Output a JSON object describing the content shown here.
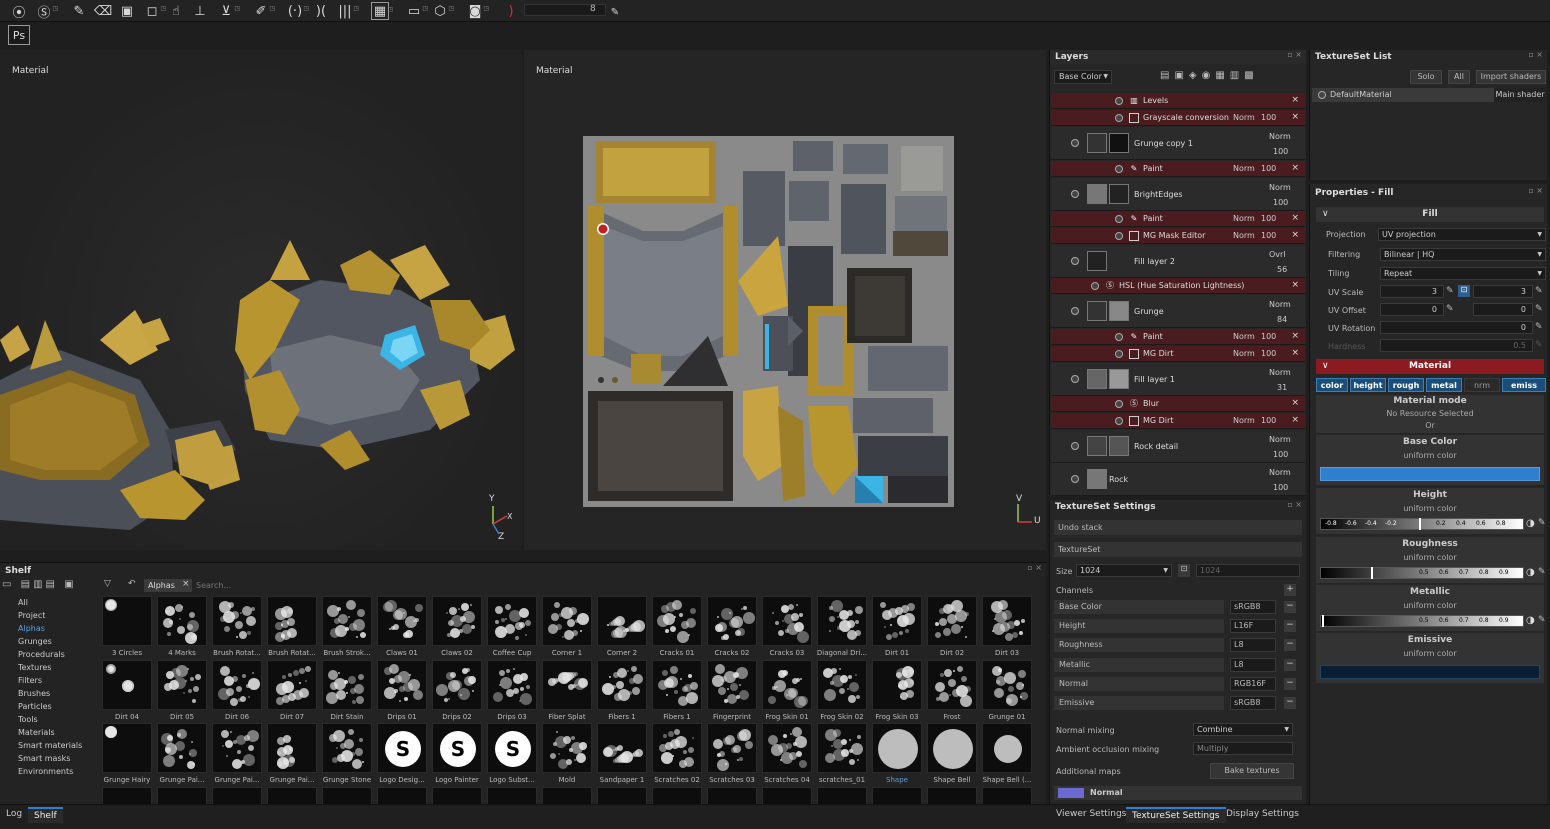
{
  "toolbar": {
    "icons": [
      "substance-logo-icon",
      "substance-s-icon",
      "brush-icon",
      "eraser-icon",
      "projection-icon",
      "polygon-fill-icon",
      "smudge-icon",
      "clone-icon",
      "clone-stamp-icon",
      "picker-icon",
      "symmetry-icon",
      "mirror-icon",
      "mirror-alt-icon",
      "texture-icon",
      "camera-icon",
      "cube-icon",
      "screenshot-icon",
      "bracket-icon"
    ],
    "slider_value": "8",
    "ps_label": "Ps"
  },
  "viewport3d": {
    "label": "Material",
    "axis_y": "Y",
    "axis_x": "X",
    "axis_z": "Z"
  },
  "viewport2d": {
    "label": "Material",
    "axis_v": "V",
    "axis_u": "U"
  },
  "layers": {
    "title": "Layers",
    "channel_select": "Base Color",
    "rows": [
      {
        "name": "Levels",
        "blend": "",
        "opacity": ""
      },
      {
        "name": "Grayscale conversion",
        "blend": "Norm",
        "opacity": "100"
      },
      {
        "name": "Grunge copy 1",
        "blend": "Norm",
        "opacity": "100"
      },
      {
        "name": "Paint",
        "blend": "Norm",
        "opacity": "100"
      },
      {
        "name": "BrightEdges",
        "blend": "Norm",
        "opacity": "100"
      },
      {
        "name": "Paint",
        "blend": "Norm",
        "opacity": "100"
      },
      {
        "name": "MG Mask Editor",
        "blend": "Norm",
        "opacity": "100"
      },
      {
        "name": "Fill layer 2",
        "blend": "Ovrl",
        "opacity": "56"
      },
      {
        "name": "HSL (Hue Saturation Lightness)",
        "blend": "",
        "opacity": ""
      },
      {
        "name": "Grunge",
        "blend": "Norm",
        "opacity": "84"
      },
      {
        "name": "Paint",
        "blend": "Norm",
        "opacity": "100"
      },
      {
        "name": "MG Dirt",
        "blend": "Norm",
        "opacity": "100"
      },
      {
        "name": "Fill layer 1",
        "blend": "Norm",
        "opacity": "31"
      },
      {
        "name": "Blur",
        "blend": "",
        "opacity": ""
      },
      {
        "name": "MG Dirt",
        "blend": "Norm",
        "opacity": "100"
      },
      {
        "name": "Rock detail",
        "blend": "Norm",
        "opacity": "100"
      },
      {
        "name": "Rock",
        "blend": "Norm",
        "opacity": "100"
      }
    ]
  },
  "texture_set_list": {
    "title": "TextureSet List",
    "solo": "Solo",
    "all": "All",
    "import": "Import shaders",
    "material": "DefaultMaterial",
    "shader": "Main shader"
  },
  "properties": {
    "title": "Properties - Fill",
    "fill_header": "Fill",
    "projection_label": "Projection",
    "projection_value": "UV projection",
    "filtering_label": "Filtering",
    "filtering_value": "Bilinear | HQ",
    "tiling_label": "Tiling",
    "tiling_value": "Repeat",
    "uvscale_label": "UV Scale",
    "uvscale_a": "3",
    "uvscale_b": "3",
    "uvoffset_label": "UV Offset",
    "uvoffset_a": "0",
    "uvoffset_b": "0",
    "uvrotation_label": "UV Rotation",
    "uvrotation_value": "0",
    "hardness_label": "Hardness",
    "hardness_value": "0.5",
    "material_header": "Material",
    "channel_tabs": [
      "color",
      "height",
      "rough",
      "metal",
      "nrm",
      "emiss"
    ],
    "material_mode": "Material mode",
    "no_resource": "No Resource Selected",
    "or": "Or",
    "base_color": "Base Color",
    "height": "Height",
    "roughness": "Roughness",
    "metallic": "Metallic",
    "emissive": "Emissive",
    "uniform": "uniform color",
    "base_color_hex": "#2f7fd0",
    "emissive_hex": "#0a1f36",
    "height_ticks": [
      "-0.8",
      "-0.6",
      "-0.4",
      "-0.2",
      "0.2",
      "0.4",
      "0.6",
      "0.8"
    ],
    "unit_ticks": [
      "0.5",
      "0.6",
      "0.7",
      "0.8",
      "0.9"
    ]
  },
  "texture_set_settings": {
    "title": "TextureSet Settings",
    "undo": "Undo stack",
    "textureset": "TextureSet",
    "size_label": "Size",
    "size_value": "1024",
    "size_value2": "1024",
    "channels_label": "Channels",
    "channels": [
      {
        "name": "Base Color",
        "format": "sRGB8"
      },
      {
        "name": "Height",
        "format": "L16F"
      },
      {
        "name": "Roughness",
        "format": "L8"
      },
      {
        "name": "Metallic",
        "format": "L8"
      },
      {
        "name": "Normal",
        "format": "RGB16F"
      },
      {
        "name": "Emissive",
        "format": "sRGB8"
      }
    ],
    "normal_mixing_label": "Normal mixing",
    "normal_mixing_value": "Combine",
    "ao_mixing_label": "Ambient occlusion mixing",
    "ao_mixing_value": "Multiply",
    "additional_maps": "Additional maps",
    "bake": "Bake textures",
    "normal_map": "Normal"
  },
  "shelf": {
    "title": "Shelf",
    "filter_tag": "Alphas",
    "search_placeholder": "Search...",
    "categories": [
      "All",
      "Project",
      "Alphas",
      "Grunges",
      "Procedurals",
      "Textures",
      "Filters",
      "Brushes",
      "Particles",
      "Tools",
      "Materials",
      "Smart materials",
      "Smart masks",
      "Environments"
    ],
    "row1": [
      "3 Circles",
      "4 Marks",
      "Brush Rotat...",
      "Brush Rotat...",
      "Brush Strok...",
      "Claws 01",
      "Claws 02",
      "Coffee Cup",
      "Corner 1",
      "Corner 2",
      "Cracks 01",
      "Cracks 02",
      "Cracks 03",
      "Diagonal Dri...",
      "Dirt 01",
      "Dirt 02",
      "Dirt 03"
    ],
    "row2": [
      "Dirt 04",
      "Dirt 05",
      "Dirt 06",
      "Dirt 07",
      "Dirt Stain",
      "Drips 01",
      "Drips 02",
      "Drips 03",
      "Fiber Splat",
      "Fibers 1",
      "Fibers 1",
      "Fingerprint",
      "Frog Skin 01",
      "Frog Skin 02",
      "Frog Skin 03",
      "Frost",
      "Grunge 01"
    ],
    "row3": [
      "Grunge Hairy",
      "Grunge Pai...",
      "Grunge Pai...",
      "Grunge Pai...",
      "Grunge Stone",
      "Logo Desig...",
      "Logo Painter",
      "Logo Subst...",
      "Mold",
      "Sandpaper 1",
      "Scratches 02",
      "Scratches 03",
      "Scratches 04",
      "scratches_01",
      "Shape",
      "Shape Bell",
      "Shape Bell (..."
    ]
  },
  "bottom_tabs": {
    "log": "Log",
    "shelf": "Shelf",
    "viewer": "Viewer Settings",
    "tss": "TextureSet Settings",
    "display": "Display Settings"
  }
}
